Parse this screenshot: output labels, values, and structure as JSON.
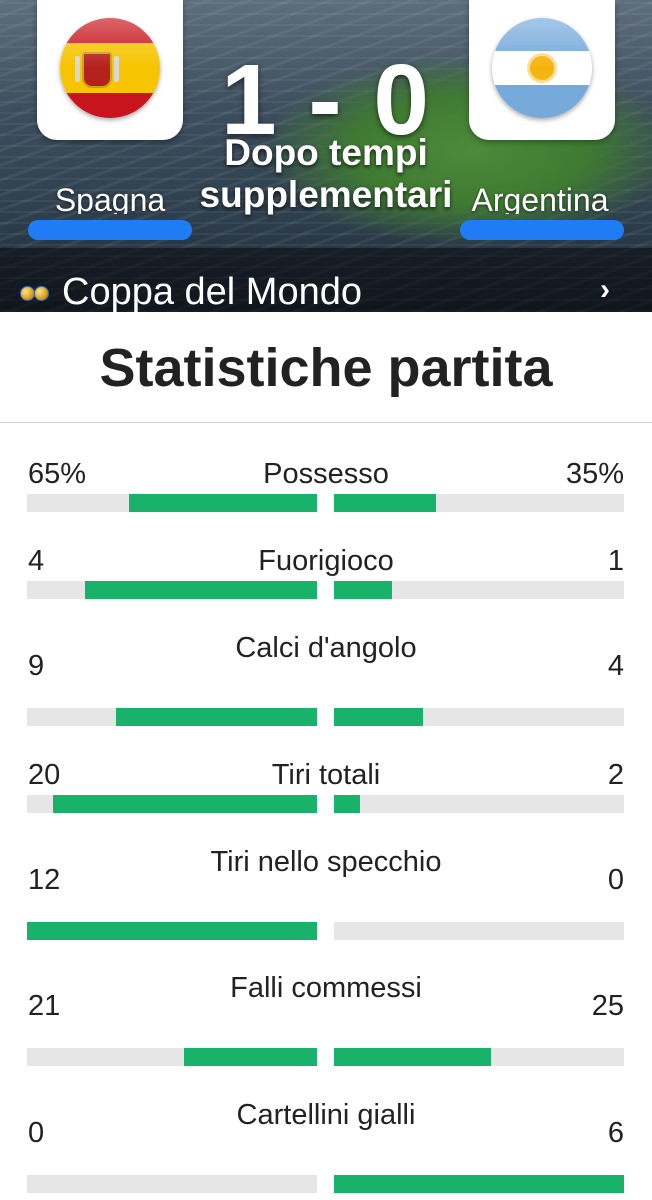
{
  "match": {
    "home_team": "Spagna",
    "away_team": "Argentina",
    "score": "1 - 0",
    "status": "Dopo tempi supplementari",
    "competition": "Coppa del Mondo",
    "home_flag_icon": "spain-flag-icon",
    "away_flag_icon": "argentina-flag-icon"
  },
  "stats_title": "Statistiche partita",
  "colors": {
    "accent_blue": "#1f7cf4",
    "bar_green": "#18b26b",
    "track_gray": "#e6e6e6"
  },
  "stats": [
    {
      "label": "Possesso",
      "home": "65%",
      "away": "35%",
      "home_fill": 0.65,
      "away_fill": 0.35
    },
    {
      "label": "Fuorigioco",
      "home": "4",
      "away": "1",
      "home_fill": 0.8,
      "away_fill": 0.2
    },
    {
      "label": "Calci d'angolo",
      "home": "9",
      "away": "4",
      "home_fill": 0.692,
      "away_fill": 0.308
    },
    {
      "label": "Tiri totali",
      "home": "20",
      "away": "2",
      "home_fill": 0.909,
      "away_fill": 0.091
    },
    {
      "label": "Tiri nello specchio",
      "home": "12",
      "away": "0",
      "home_fill": 1.0,
      "away_fill": 0.0
    },
    {
      "label": "Falli commessi",
      "home": "21",
      "away": "25",
      "home_fill": 0.457,
      "away_fill": 0.543
    },
    {
      "label": "Cartellini gialli",
      "home": "0",
      "away": "6",
      "home_fill": 0.0,
      "away_fill": 1.0
    }
  ]
}
